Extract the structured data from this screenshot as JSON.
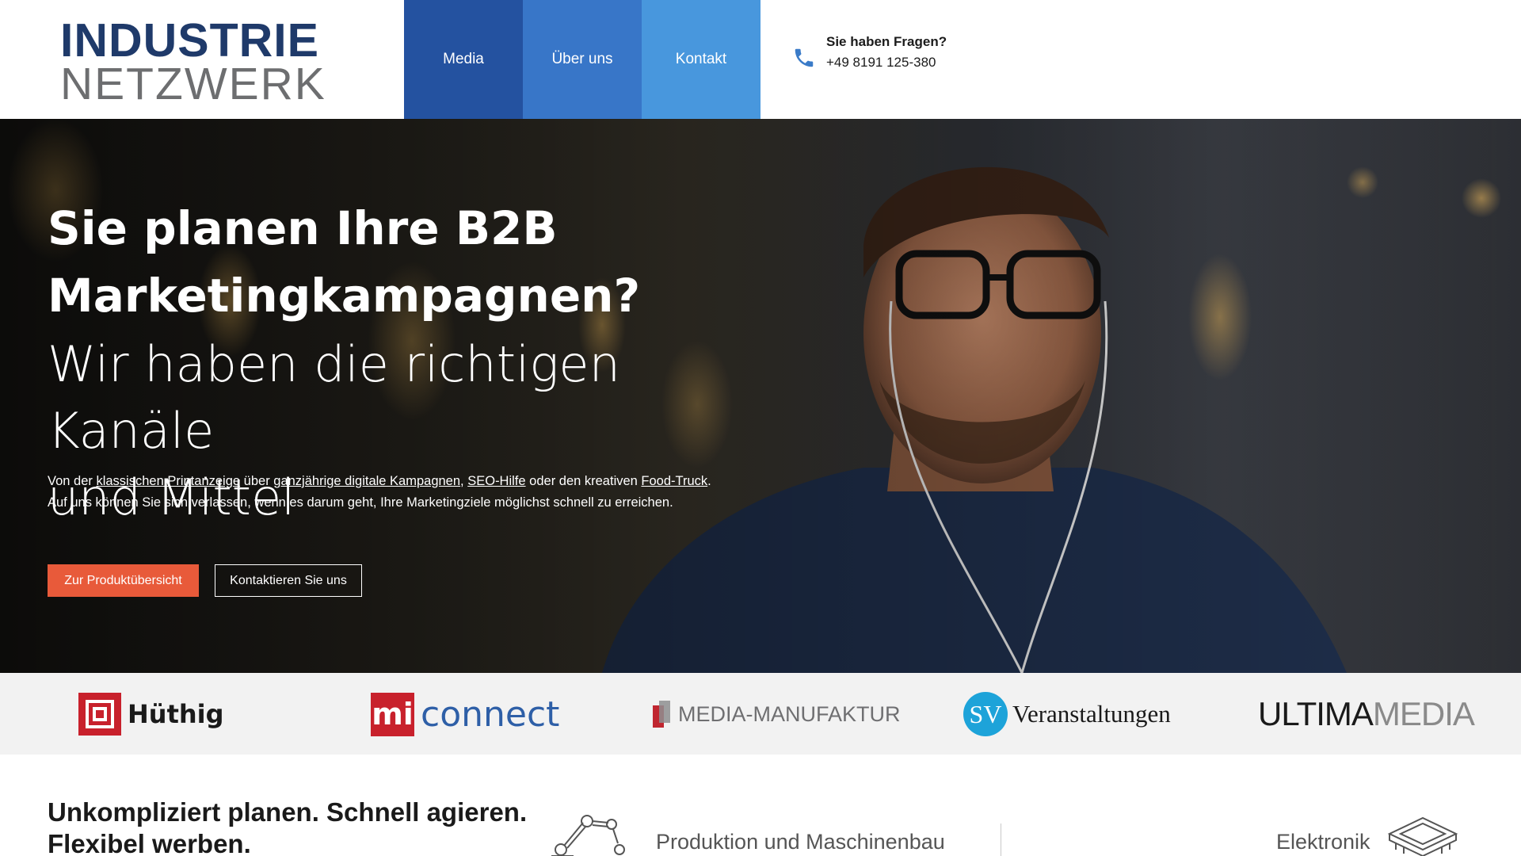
{
  "header": {
    "logo_line1": "INDUSTRIE",
    "logo_line2": "NETZWERK",
    "nav": [
      {
        "label": "Media"
      },
      {
        "label": "Über uns"
      },
      {
        "label": "Kontakt"
      }
    ],
    "contact_question": "Sie haben Fragen?",
    "contact_phone": "+49 8191 125-380",
    "contact_icon": "phone-icon"
  },
  "hero": {
    "title_line1": "Sie planen Ihre B2B",
    "title_line2": "Marketingkampagnen?",
    "subtitle_line1": "Wir haben die richtigen Kanäle",
    "subtitle_line2": "und Mittel",
    "text_intro": "Von der ",
    "link_print": "klassischen Printanzeige",
    "text_uber": " über ",
    "link_digital": "ganzjährige digitale Kampagnen",
    "text_comma": ", ",
    "link_seo": "SEO-Hilfe",
    "text_oder": " oder den kreativen ",
    "link_foodtruck": "Food-Truck",
    "text_period": ".",
    "text_line2": "Auf uns können Sie sich verlassen, wenn es darum geht, Ihre Marketingziele möglichst schnell zu erreichen.",
    "btn_primary": "Zur Produktübersicht",
    "btn_secondary": "Kontaktieren Sie uns"
  },
  "brands": {
    "huthig": "Hüthig",
    "mi_mark": "mi",
    "mi_name": "connect",
    "media_manufaktur": "MEDIA-MANUFAKTUR",
    "sv_mark": "SV",
    "sv_name": "Veranstaltungen",
    "ultima_1": "ULTIMA",
    "ultima_2": "MEDIA"
  },
  "section": {
    "title_line1": "Unkompliziert planen. Schnell agieren.",
    "title_line2": "Flexibel werben.",
    "category_1": "Produktion und Maschinenbau",
    "category_2": "Elektronik"
  },
  "colors": {
    "nav_media": "#2452a0",
    "nav_about": "#3876c8",
    "nav_contact": "#4897dd",
    "cta": "#e85a3a",
    "logo_blue": "#1f3a6a"
  }
}
